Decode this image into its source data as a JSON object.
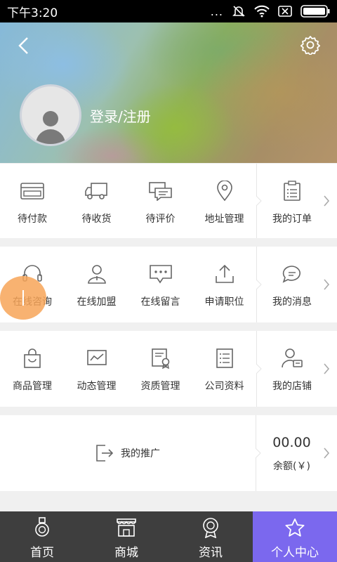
{
  "status_bar": {
    "time": "下午3:20",
    "dots": "..."
  },
  "header": {
    "login_label": "登录/注册"
  },
  "orders": {
    "items": [
      {
        "label": "待付款",
        "icon": "wallet-icon"
      },
      {
        "label": "待收货",
        "icon": "truck-icon"
      },
      {
        "label": "待评价",
        "icon": "comment-icon"
      },
      {
        "label": "地址管理",
        "icon": "location-pin-icon"
      }
    ],
    "side": {
      "label": "我的订单",
      "icon": "clipboard-icon"
    }
  },
  "services": {
    "items": [
      {
        "label": "在线咨询",
        "icon": "headset-icon"
      },
      {
        "label": "在线加盟",
        "icon": "person-icon"
      },
      {
        "label": "在线留言",
        "icon": "message-icon"
      },
      {
        "label": "申请职位",
        "icon": "upload-icon"
      }
    ],
    "side": {
      "label": "我的消息",
      "icon": "chat-bubble-icon"
    }
  },
  "management": {
    "items": [
      {
        "label": "商品管理",
        "icon": "shopping-bag-icon"
      },
      {
        "label": "动态管理",
        "icon": "trend-chart-icon"
      },
      {
        "label": "资质管理",
        "icon": "certificate-icon"
      },
      {
        "label": "公司资料",
        "icon": "document-list-icon"
      }
    ],
    "side": {
      "label": "我的店铺",
      "icon": "store-user-icon"
    }
  },
  "promotion": {
    "label": "我的推广",
    "amount": "00.00",
    "balance_label": "余额(￥)"
  },
  "bottom_nav": {
    "items": [
      {
        "label": "首页",
        "icon": "medal-icon",
        "active": false
      },
      {
        "label": "商城",
        "icon": "storefront-icon",
        "active": false
      },
      {
        "label": "资讯",
        "icon": "badge-icon",
        "active": false
      },
      {
        "label": "个人中心",
        "icon": "star-icon",
        "active": true
      }
    ]
  },
  "colors": {
    "nav_active": "#7b68ee",
    "nav_bg": "#3e3e3e",
    "fab": "#f7a558",
    "icon_gray": "#666666"
  }
}
